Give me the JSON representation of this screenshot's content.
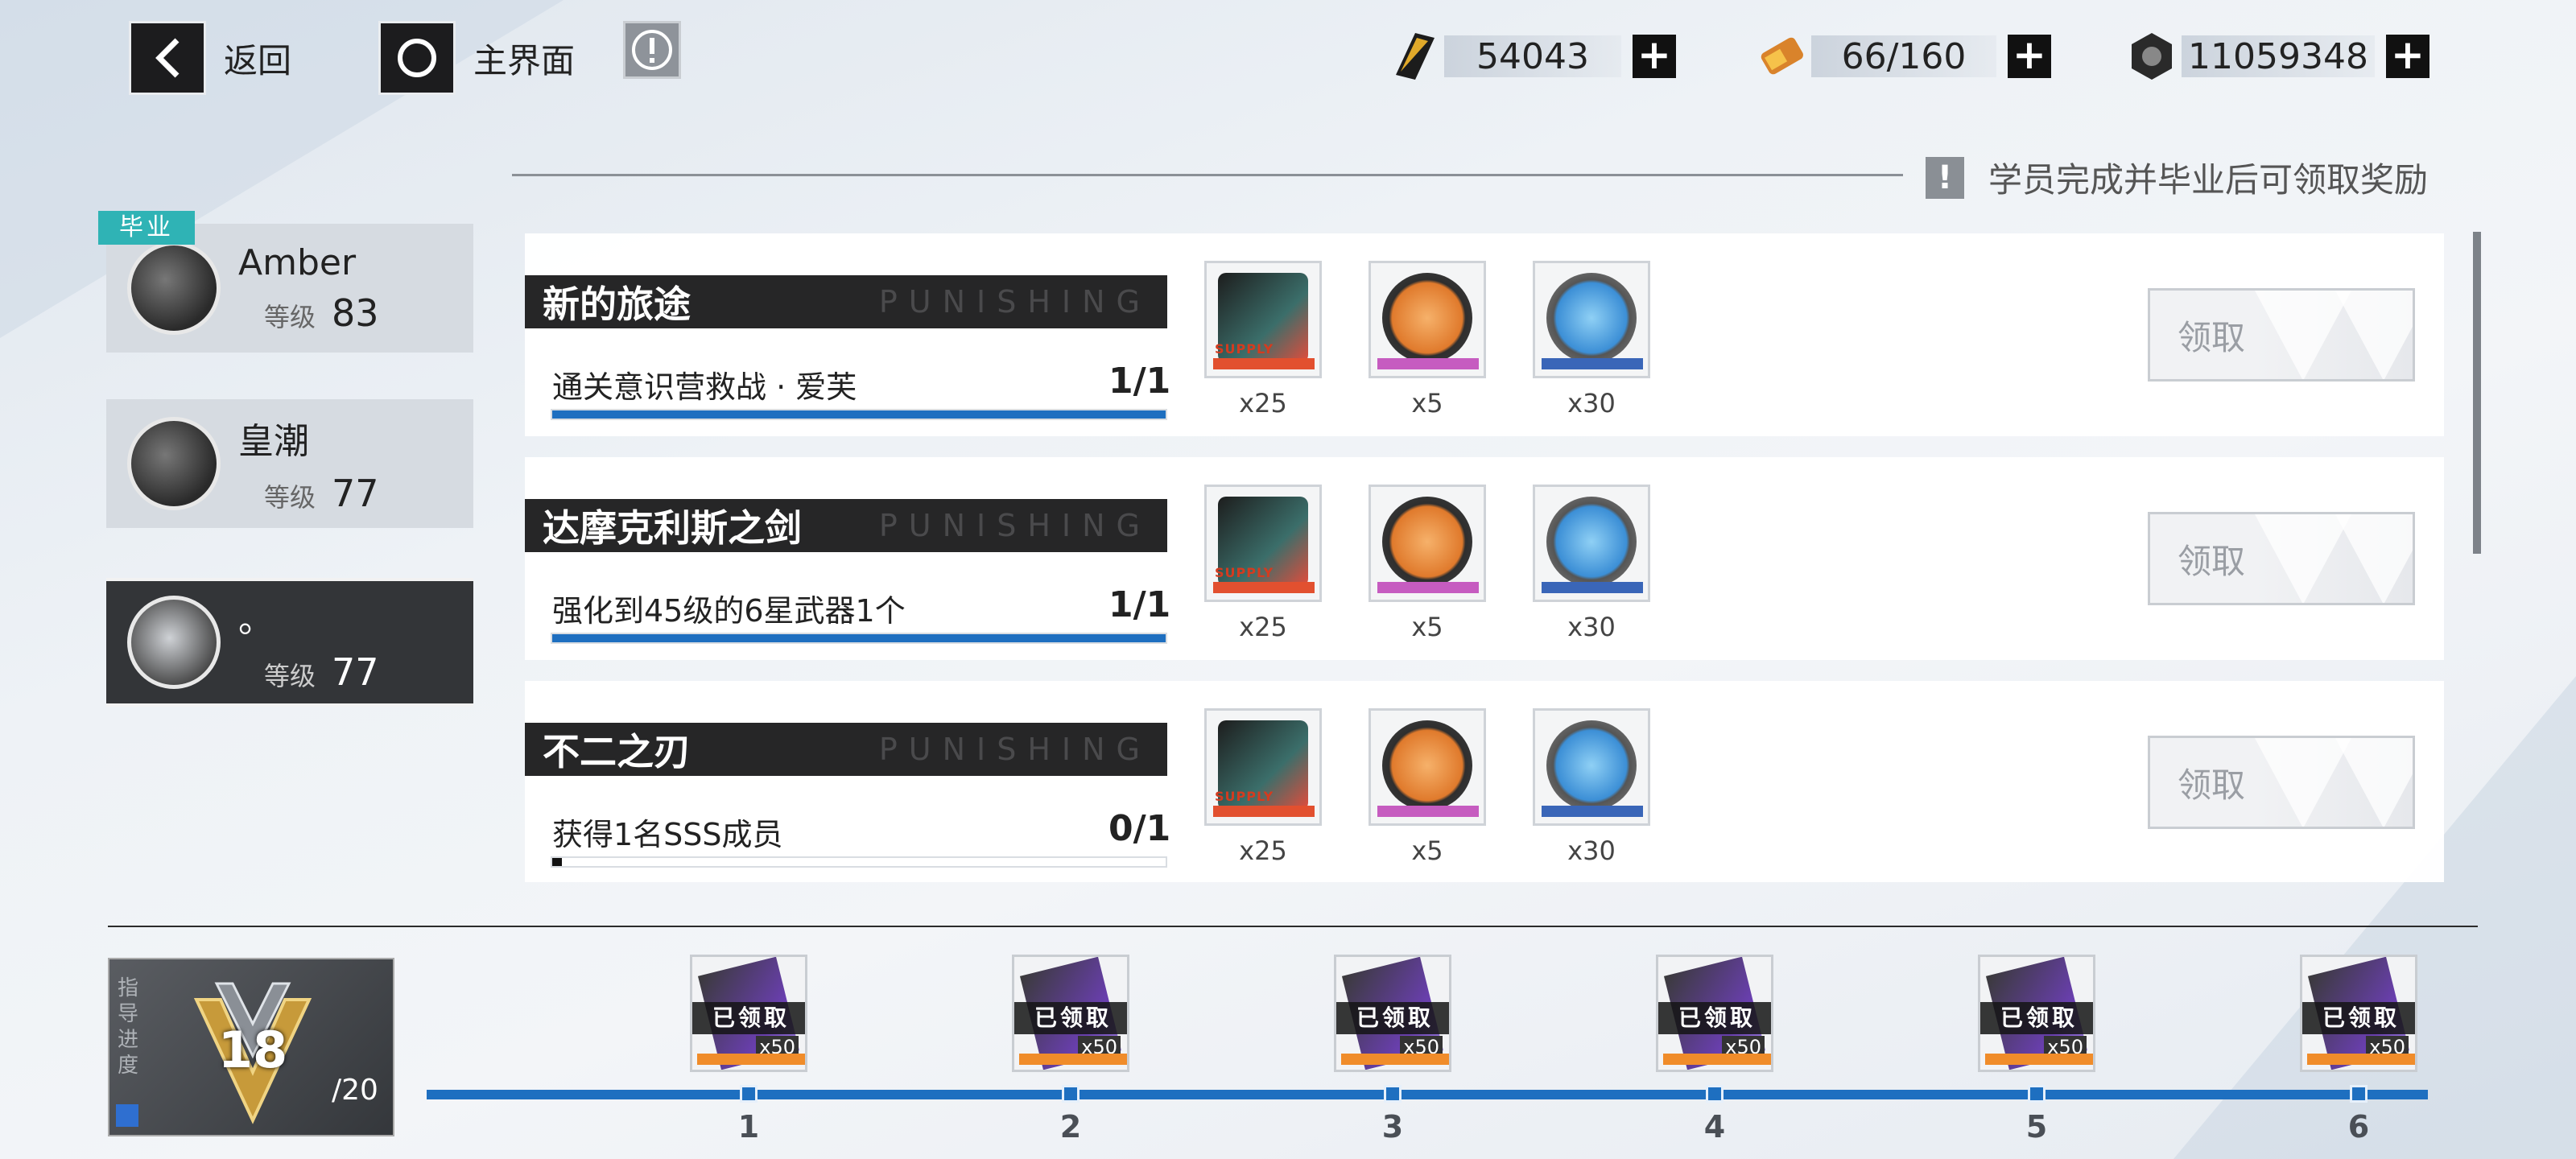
{
  "nav": {
    "back_label": "返回",
    "home_label": "主界面"
  },
  "resources": [
    {
      "icon": "black-card-icon",
      "value": "54043"
    },
    {
      "icon": "stamina-battery-icon",
      "value": "66/160"
    },
    {
      "icon": "coin-icon",
      "value": "11059348"
    }
  ],
  "notice": "学员完成并毕业后可领取奖励",
  "members": [
    {
      "name": "Amber",
      "level_label": "等级",
      "level": "83",
      "badge": "毕业"
    },
    {
      "name": "皇潮",
      "level_label": "等级",
      "level": "77"
    },
    {
      "name": "。",
      "level_label": "等级",
      "level": "77"
    }
  ],
  "tasks": [
    {
      "title": "新的旅途",
      "watermark": "PUNISHING",
      "desc": "通关意识营救战 · 爱芙",
      "progress": "1/1",
      "progress_fraction": 1.0,
      "rewards": [
        {
          "icon": "supply-chip-icon",
          "qty": "x25"
        },
        {
          "icon": "orange-coin-icon",
          "qty": "x5"
        },
        {
          "icon": "blue-coin-icon",
          "qty": "x30"
        }
      ],
      "claim_label": "领取"
    },
    {
      "title": "达摩克利斯之剑",
      "watermark": "PUNISHING",
      "desc": "强化到45级的6星武器1个",
      "progress": "1/1",
      "progress_fraction": 1.0,
      "rewards": [
        {
          "icon": "supply-chip-icon",
          "qty": "x25"
        },
        {
          "icon": "orange-coin-icon",
          "qty": "x5"
        },
        {
          "icon": "blue-coin-icon",
          "qty": "x30"
        }
      ],
      "claim_label": "领取"
    },
    {
      "title": "不二之刃",
      "watermark": "PUNISHING",
      "desc": "获得1名SSS成员",
      "progress": "0/1",
      "progress_fraction": 0.0,
      "rewards": [
        {
          "icon": "supply-chip-icon",
          "qty": "x25"
        },
        {
          "icon": "orange-coin-icon",
          "qty": "x5"
        },
        {
          "icon": "blue-coin-icon",
          "qty": "x30"
        }
      ],
      "claim_label": "领取"
    }
  ],
  "guide": {
    "label": "指导进度",
    "current": "18",
    "total": "/20"
  },
  "milestones": [
    {
      "num": "1",
      "status": "已领取",
      "qty": "x50"
    },
    {
      "num": "2",
      "status": "已领取",
      "qty": "x50"
    },
    {
      "num": "3",
      "status": "已领取",
      "qty": "x50"
    },
    {
      "num": "4",
      "status": "已领取",
      "qty": "x50"
    },
    {
      "num": "5",
      "status": "已领取",
      "qty": "x50"
    },
    {
      "num": "6",
      "status": "已领取",
      "qty": "x50"
    }
  ],
  "colors": {
    "accent": "#1e6fc0",
    "badge": "#2fb3b5",
    "title_bar": "#262627"
  }
}
